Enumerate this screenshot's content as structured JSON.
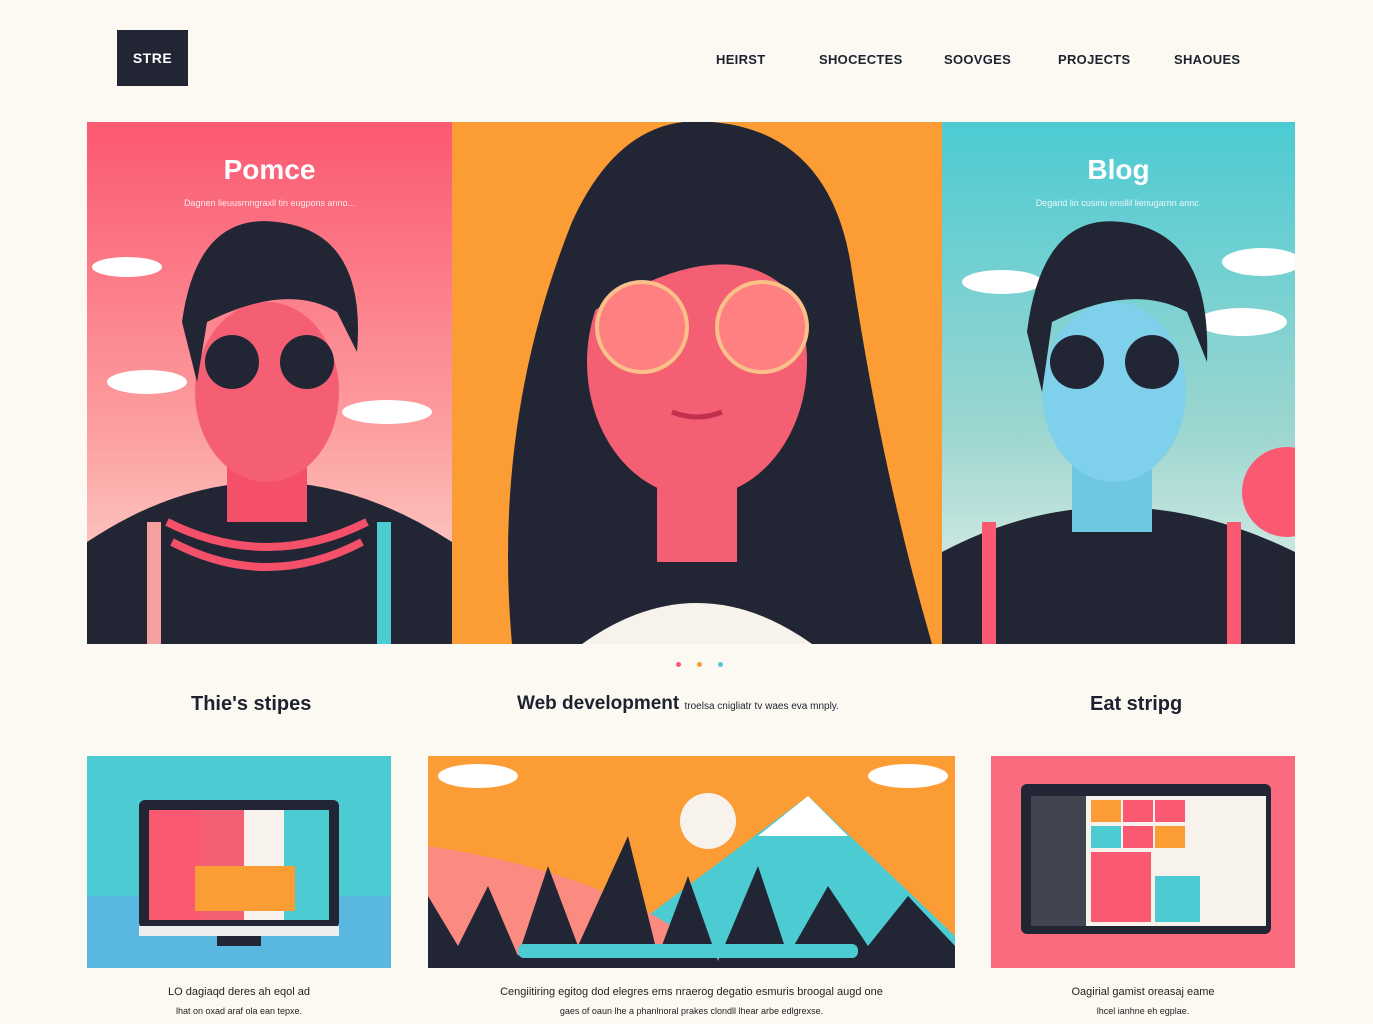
{
  "logo": "STRE",
  "nav": [
    "HEIRST",
    "SHOCECTES",
    "SOOVGES",
    "PROJECTS",
    "SHAOUES"
  ],
  "hero": [
    {
      "title": "Pomce",
      "subtitle": "Dagnen lieuusrnngraxll tin eugpons anno...",
      "color": "#fb5871"
    },
    {
      "title": "",
      "subtitle": "",
      "color": "#fc9c34"
    },
    {
      "title": "Blog",
      "subtitle": "Degarid lin cusinu ensllil lienugarnn annc.",
      "color": "#4ccbd3"
    }
  ],
  "sections": {
    "left": "Thie's stipes",
    "middle": "Web development",
    "middle_small": "troelsa cnigliatr tv waes eva mnply.",
    "right": "Eat stripg"
  },
  "captions": [
    {
      "line1": "LO dagiaqd deres ah eqol ad",
      "line2": "lhat on oxad araf ola ean tepxe."
    },
    {
      "line1": "Cengiitiring egitog dod elegres ems nraerog degatio esmuris broogal augd one",
      "line2": "gaes of oaun lhe a phanlnoral prakes clondll lhear arbe edlgrexse."
    },
    {
      "line1": "Oagirial gamist oreasaj eame",
      "line2": "lhcel ianhne eh egplae."
    }
  ]
}
